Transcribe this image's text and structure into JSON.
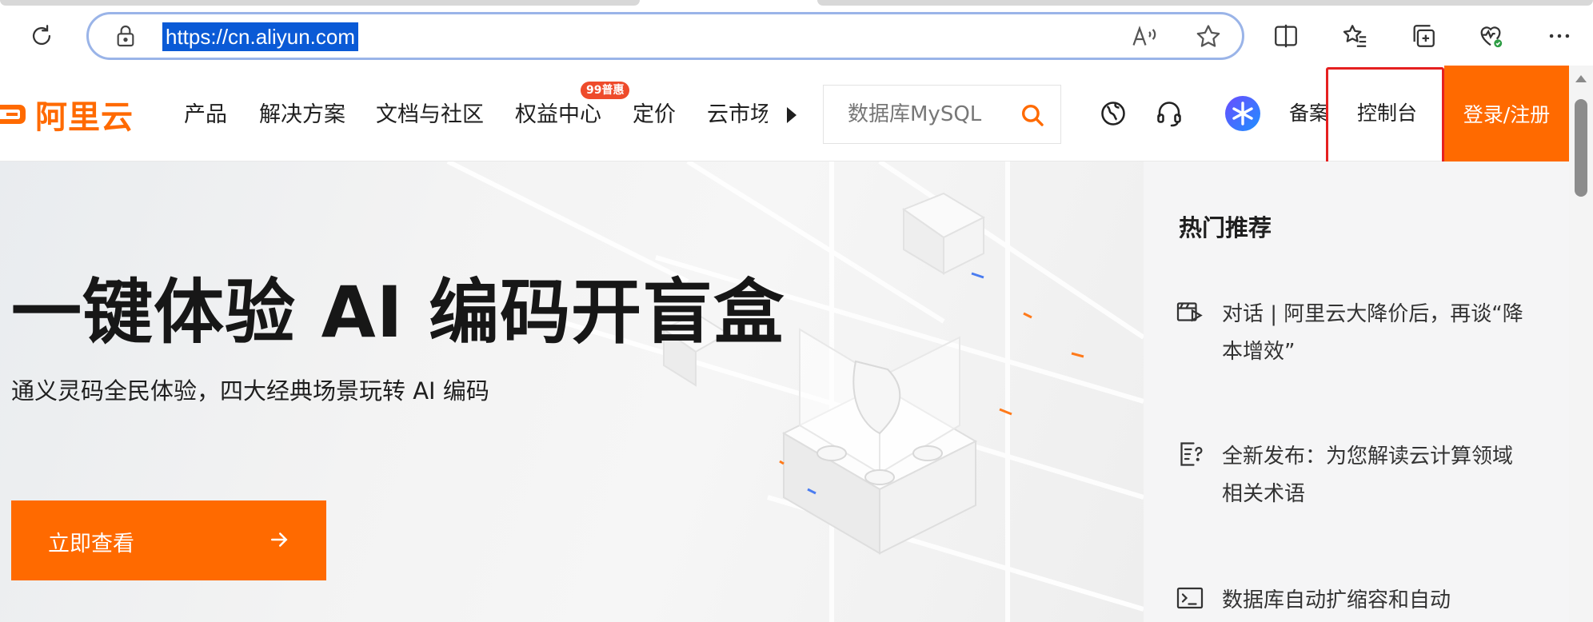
{
  "browser": {
    "url": "https://cn.aliyun.com",
    "icons": [
      "refresh-icon",
      "lock-icon",
      "read-aloud-icon",
      "favorite-star-icon",
      "split-screen-icon",
      "favorites-icon",
      "collections-icon",
      "browser-essentials-icon",
      "more-icon"
    ]
  },
  "header": {
    "logo_text": "阿里云",
    "nav": [
      "产品",
      "解决方案",
      "文档与社区",
      "权益中心",
      "定价",
      "云市场"
    ],
    "promo_badge": "99普惠",
    "search_placeholder": "数据库MySQL",
    "icons": [
      "globe-icon",
      "headset-icon",
      "ai-assistant-icon"
    ],
    "beian": "备案",
    "console": "控制台",
    "login": "登录/注册",
    "accent_color": "#ff6a00",
    "highlight_color": "#e52020"
  },
  "hero": {
    "title": "一键体验 AI 编码开盲盒",
    "subtitle": "通义灵码全民体验，四大经典场景玩转 AI 编码",
    "cta": "立即查看"
  },
  "sidebar": {
    "title": "热门推荐",
    "items": [
      {
        "icon": "video-icon",
        "text": "对话 |  阿里云大降价后，再谈“降本增效”"
      },
      {
        "icon": "doc-question-icon",
        "text": "全新发布：为您解读云计算领域相关术语"
      },
      {
        "icon": "terminal-icon",
        "text": "数据库自动扩缩容和自动"
      }
    ]
  }
}
